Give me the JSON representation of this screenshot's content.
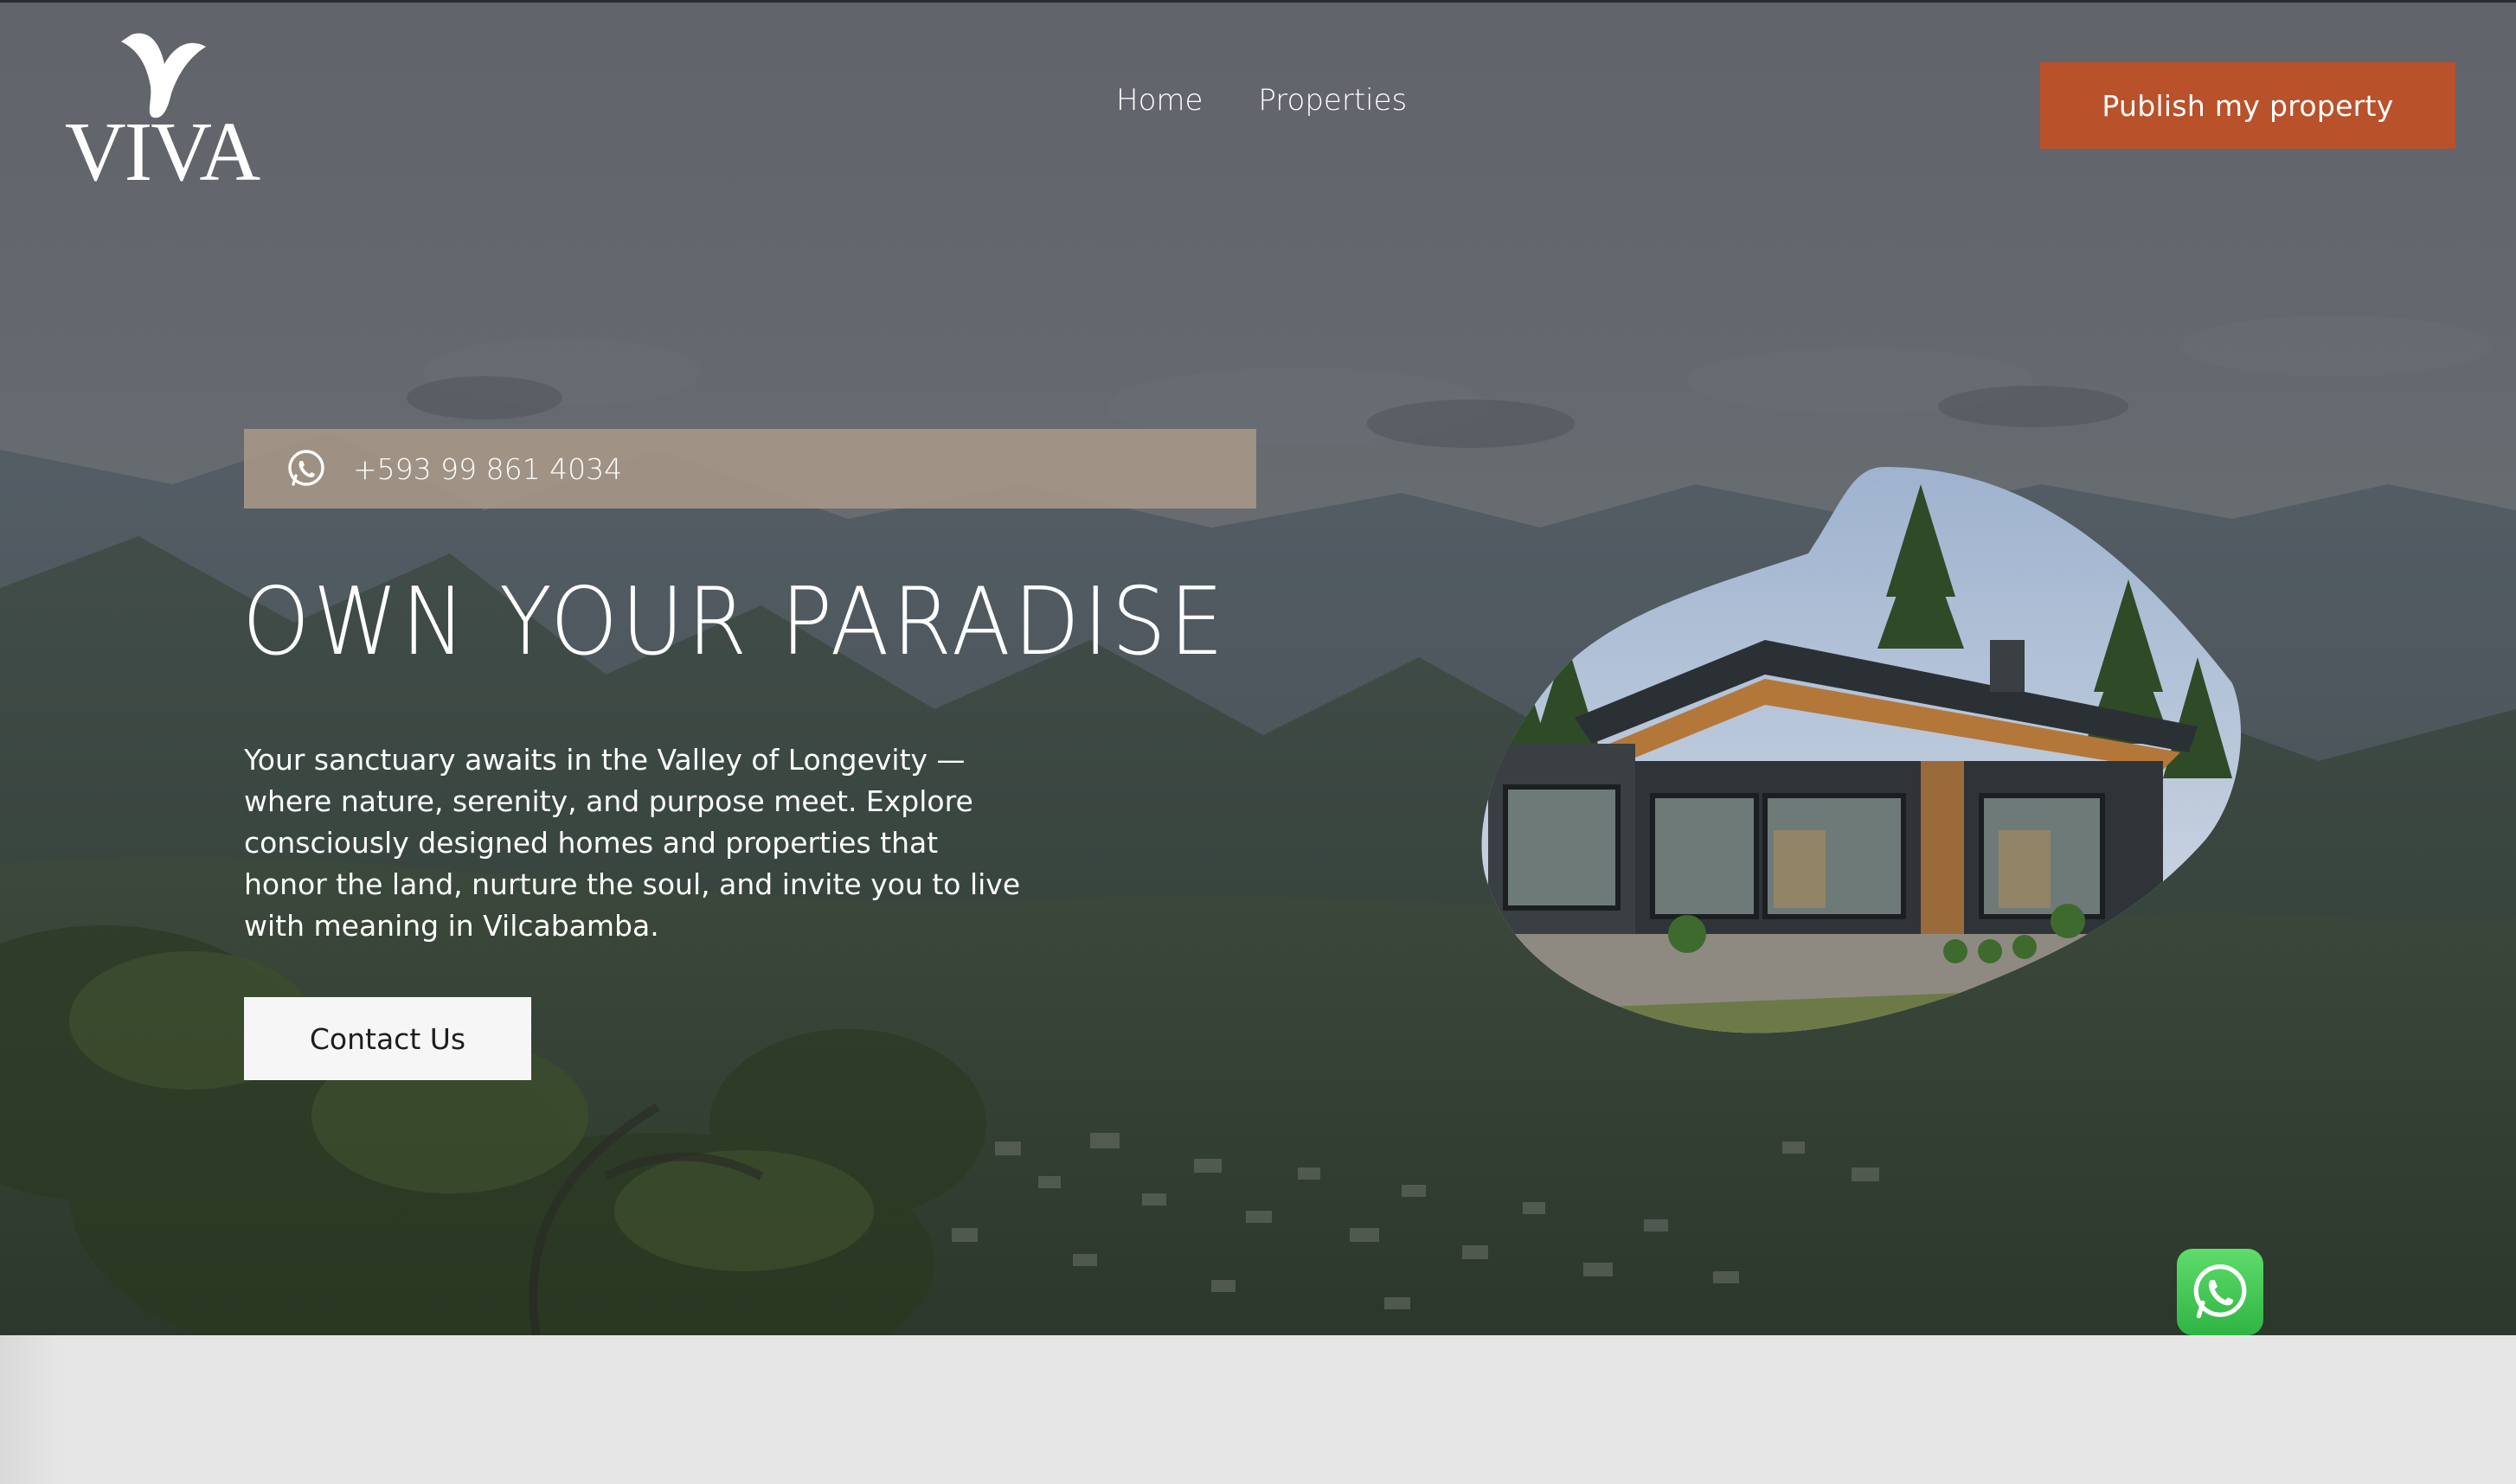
{
  "brand": {
    "name": "VIVA"
  },
  "nav": {
    "items": [
      {
        "label": "Home"
      },
      {
        "label": "Properties"
      }
    ]
  },
  "header": {
    "publish_label": "Publish my property"
  },
  "hero": {
    "phone": "+593 99 861 4034",
    "headline": "OWN YOUR PARADISE",
    "description": "Your sanctuary awaits in the Valley of Longevity — where nature, serenity, and purpose meet. Explore consciously designed homes and properties that honor the land, nurture the soul, and invite you to live with meaning in Vilcabamba.",
    "cta_label": "Contact Us"
  },
  "icons": {
    "logo": "viva-logo",
    "phone": "whatsapp-icon",
    "float": "whatsapp-icon"
  },
  "colors": {
    "accent": "#b9512b",
    "phone_bar": "#a89887",
    "whatsapp": "#3cc04f",
    "footer": "#e6e6e6"
  }
}
